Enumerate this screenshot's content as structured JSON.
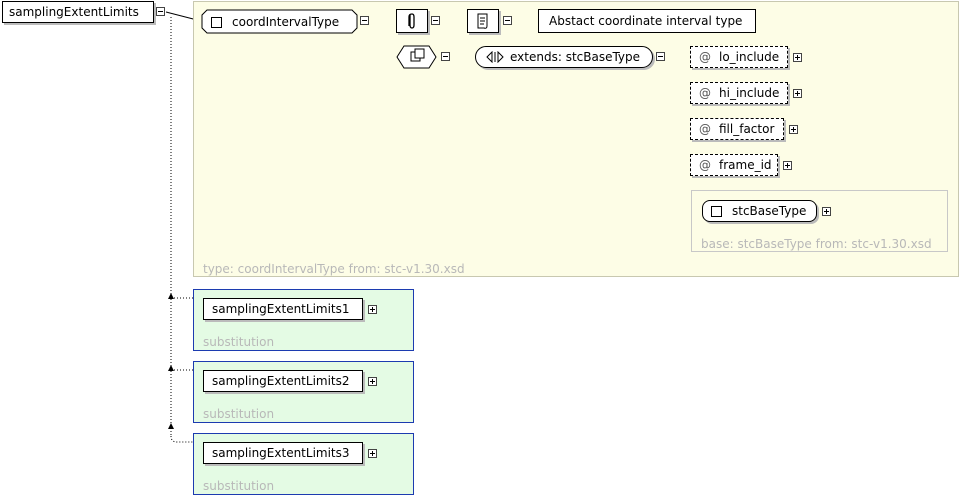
{
  "root": {
    "label": "samplingExtentLimits"
  },
  "type_panel": {
    "caption": "type: coordIntervalType from: stc-v1.30.xsd",
    "type_node": "coordIntervalType",
    "annotation": "Abstact coordinate interval type",
    "extends": "extends: stcBaseType",
    "attributes": [
      "lo_include",
      "hi_include",
      "fill_factor",
      "frame_id"
    ],
    "attribute_prefix": "@",
    "base": {
      "node": "stcBaseType",
      "caption": "base: stcBaseType from: stc-v1.30.xsd"
    }
  },
  "substitutions": [
    {
      "label": "samplingExtentLimits1",
      "caption": "substitution"
    },
    {
      "label": "samplingExtentLimits2",
      "caption": "substitution"
    },
    {
      "label": "samplingExtentLimits3",
      "caption": "substitution"
    }
  ],
  "colors": {
    "type_panel_bg": "#fdfde6",
    "substitution_bg": "#e4fbe4",
    "substitution_border": "#1c3bb0",
    "caption_text": "#b8b8b8"
  }
}
